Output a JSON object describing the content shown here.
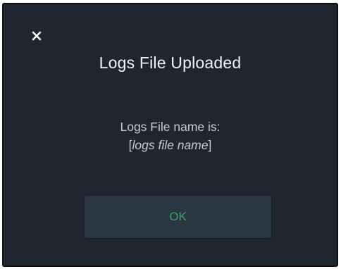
{
  "dialog": {
    "title": "Logs File Uploaded",
    "message_line1": "Logs File name is:",
    "bracket_open": "[",
    "file_name": "logs file name",
    "bracket_close": "]",
    "ok_label": "OK",
    "close_icon": "close-icon"
  },
  "colors": {
    "background": "#1f2630",
    "button": "#2c3744",
    "ok_text": "#3f9e6a",
    "title_text": "#f2f3f4"
  }
}
